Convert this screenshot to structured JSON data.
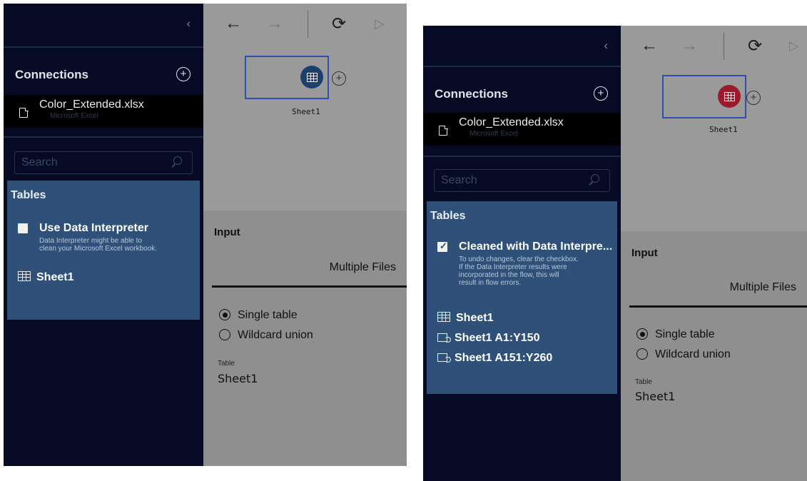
{
  "panel_before": {
    "collapse_glyph": "‹",
    "connections": {
      "heading": "Connections",
      "file_name": "Color_Extended.xlsx",
      "file_type": "Microsoft Excel"
    },
    "search": {
      "placeholder": "Search"
    },
    "tables": {
      "heading": "Tables",
      "interpreter_checked": false,
      "interpreter_label": "Use Data Interpreter",
      "interpreter_note": [
        "Data Interpreter might be able to",
        "clean your Microsoft Excel workbook."
      ],
      "items": [
        "Sheet1"
      ]
    },
    "flow": {
      "node_label": "Sheet1",
      "node_color": "#1d3f6e"
    },
    "input": {
      "heading": "Input",
      "tab_label": "Multiple Files",
      "radio_options": [
        "Single table",
        "Wildcard union"
      ],
      "selected_option": "Single table",
      "table_label": "Table",
      "table_value": "Sheet1"
    }
  },
  "panel_after": {
    "collapse_glyph": "‹",
    "connections": {
      "heading": "Connections",
      "file_name": "Color_Extended.xlsx",
      "file_type": "Microsoft Excel"
    },
    "search": {
      "placeholder": "Search"
    },
    "tables": {
      "heading": "Tables",
      "interpreter_checked": true,
      "interpreter_label": "Cleaned with Data Interpre...",
      "interpreter_note": [
        "To undo changes, clear the checkbox.",
        "If the Data Interpreter results were",
        "incorporated in the flow, this will",
        "result in flow errors."
      ],
      "items": [
        "Sheet1",
        "Sheet1 A1:Y150",
        "Sheet1 A151:Y260"
      ]
    },
    "flow": {
      "node_label": "Sheet1",
      "node_color": "#9b1b2c"
    },
    "input": {
      "heading": "Input",
      "tab_label": "Multiple Files",
      "radio_options": [
        "Single table",
        "Wildcard union"
      ],
      "selected_option": "Single table",
      "table_label": "Table",
      "table_value": "Sheet1"
    }
  },
  "icons": {
    "back": "arrow-left-icon",
    "forward": "arrow-right-icon",
    "refresh": "refresh-icon",
    "run": "play-icon",
    "add": "plus-circle-icon"
  }
}
